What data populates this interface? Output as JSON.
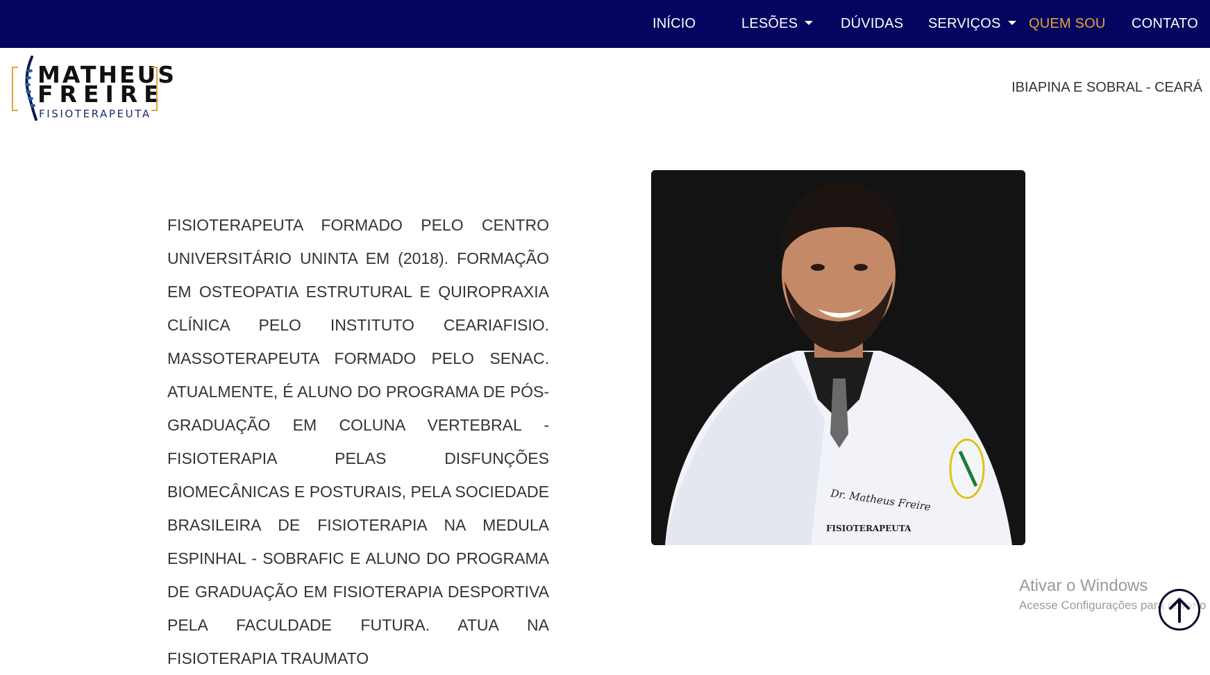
{
  "nav": {
    "items": [
      {
        "label": "INÍCIO",
        "dropdown": false,
        "active": false
      },
      {
        "label": "LESÕES",
        "dropdown": true,
        "active": false
      },
      {
        "label": "DÚVIDAS",
        "dropdown": false,
        "active": false
      },
      {
        "label": "SERVIÇOS",
        "dropdown": true,
        "active": false
      },
      {
        "label": "QUEM SOU",
        "dropdown": false,
        "active": true
      },
      {
        "label": "CONTATO",
        "dropdown": false,
        "active": false
      }
    ]
  },
  "brand": {
    "line1": "MATHEUS",
    "line2": "FREIRE",
    "line3": "FISIOTERAPEUTA"
  },
  "header": {
    "location": "IBIAPINA E SOBRAL - CEARÁ"
  },
  "main": {
    "bio": "Fisioterapeuta formado pelo Centro Universitário UNINTA em (2018). Formação em Osteopatia Estrutural e Quiropraxia Clínica pelo Instituto Ceariafisio. Massoterapeuta formado pelo SENAC. Atualmente, é aluno do programa de Pós-Graduação em Coluna Vertebral - Fisioterapia pelas Disfunções Biomecânicas e Posturais, pela Sociedade Brasileira de Fisioterapia na Medula Espinhal - SOBRAFIC e aluno do programa de Graduação em Fisioterapia Desportiva pela Faculdade Futura. Atua na Fisioterapia Traumato",
    "coat_name": "Dr. Matheus Freire",
    "coat_title": "FISIOTERAPEUTA"
  },
  "watermark": {
    "title": "Ativar o Windows",
    "subtitle": "Acesse Configurações para ativar o"
  },
  "colors": {
    "nav_bg": "#050561",
    "nav_text": "#ffffff",
    "nav_active": "#e8a33a",
    "accent_gold": "#e0a437"
  },
  "icons": {
    "dropdown": "caret-down-icon",
    "scroll_top": "arrow-up-circle-icon"
  }
}
